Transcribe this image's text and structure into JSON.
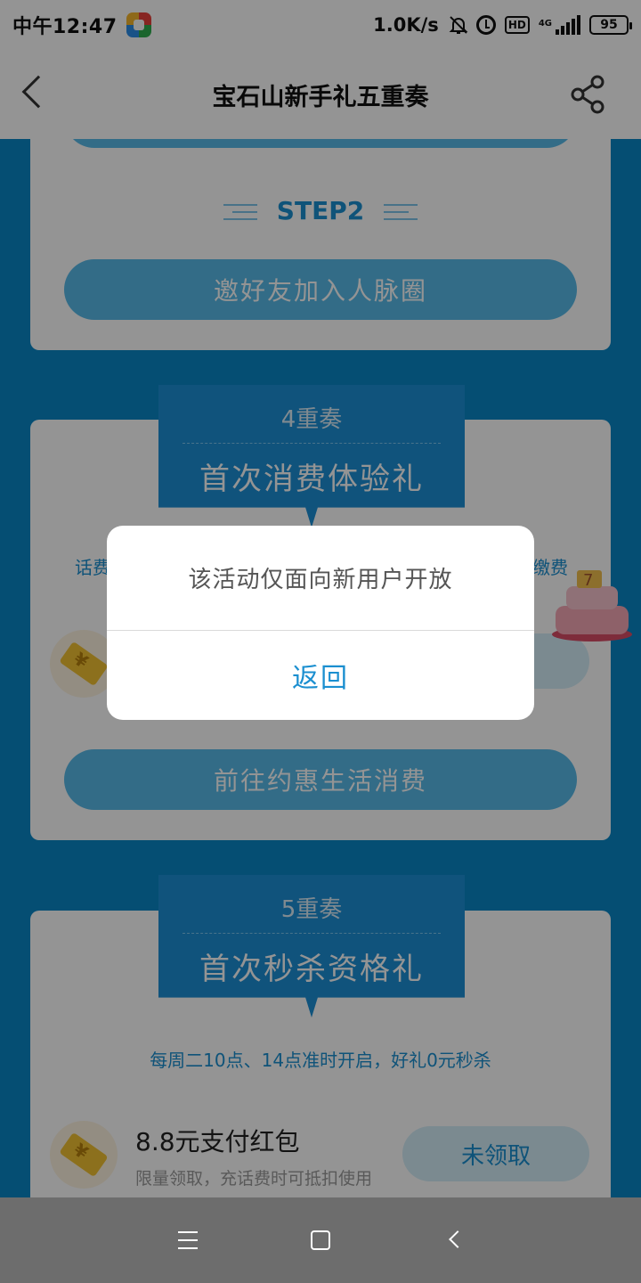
{
  "status_bar": {
    "time": "中午12:47",
    "net_speed": "1.0K/s",
    "hd_label": "HD",
    "network_label": "4G",
    "battery": "95"
  },
  "header": {
    "title": "宝石山新手礼五重奏"
  },
  "step2": {
    "label": "STEP2",
    "button": "邀好友加入人脉圈"
  },
  "section4": {
    "number": "4重奏",
    "name": "首次消费体验礼",
    "desc_left": "话费",
    "desc_right": "缴费",
    "action_button": "前往约惠生活消费"
  },
  "section5": {
    "number": "5重奏",
    "name": "首次秒杀资格礼",
    "desc": "每周二10点、14点准时开启，好礼0元秒杀",
    "item": {
      "title": "8.8元支付红包",
      "subtitle": "限量领取，充话费时可抵扣使用",
      "status_button": "未领取"
    }
  },
  "dialog": {
    "message": "该活动仅面向新用户开放",
    "button": "返回"
  }
}
